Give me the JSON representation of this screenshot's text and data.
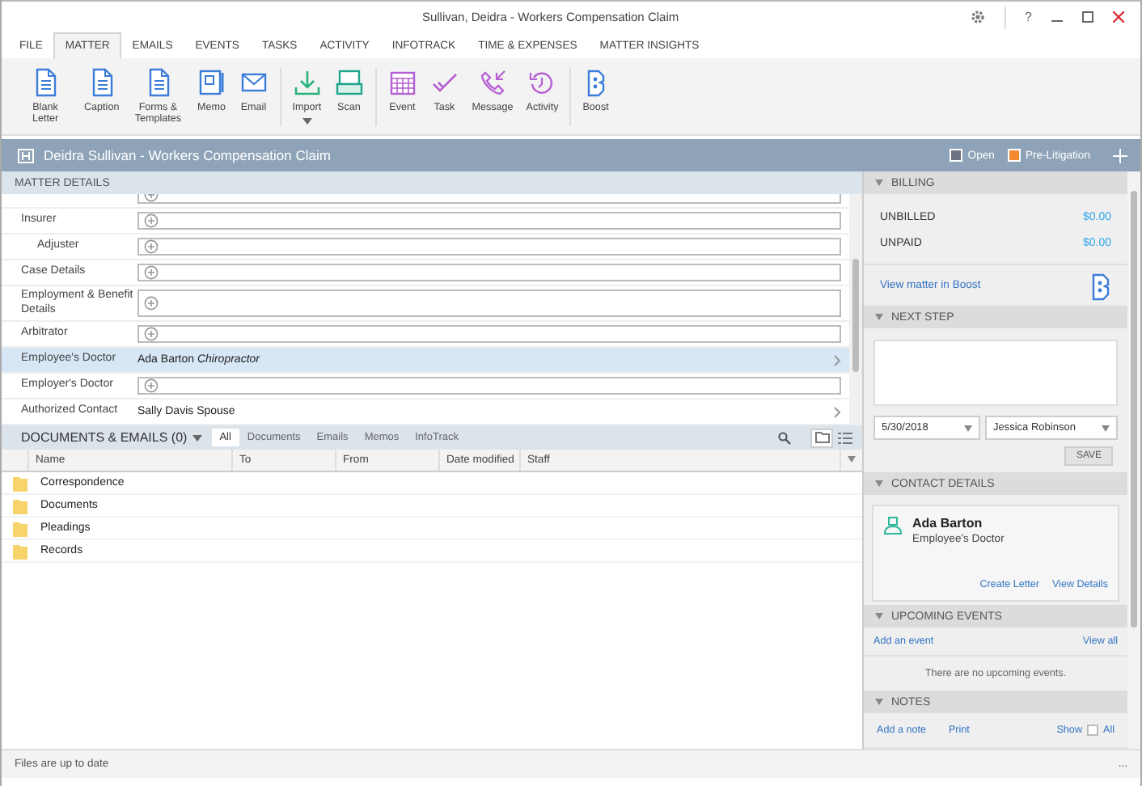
{
  "window": {
    "title": "Sullivan, Deidra - Workers Compensation Claim",
    "help": "?"
  },
  "tabs": [
    {
      "label": "FILE",
      "selected": false
    },
    {
      "label": "MATTER",
      "selected": true
    },
    {
      "label": "EMAILS",
      "selected": false
    },
    {
      "label": "EVENTS",
      "selected": false
    },
    {
      "label": "TASKS",
      "selected": false
    },
    {
      "label": "ACTIVITY",
      "selected": false
    },
    {
      "label": "INFOTRACK",
      "selected": false
    },
    {
      "label": "TIME & EXPENSES",
      "selected": false
    },
    {
      "label": "MATTER INSIGHTS",
      "selected": false
    }
  ],
  "ribbon": {
    "groups": [
      {
        "buttons": [
          {
            "label": "Blank Letter",
            "dropdown": false
          },
          {
            "label": "Caption",
            "dropdown": false
          },
          {
            "label": "Forms & Templates",
            "dropdown": false
          },
          {
            "label": "Memo",
            "dropdown": false
          },
          {
            "label": "Email",
            "dropdown": false
          }
        ]
      },
      {
        "buttons": [
          {
            "label": "Import",
            "dropdown": true
          },
          {
            "label": "Scan",
            "dropdown": false
          }
        ]
      },
      {
        "buttons": [
          {
            "label": "Event",
            "dropdown": false
          },
          {
            "label": "Task",
            "dropdown": false
          },
          {
            "label": "Message",
            "dropdown": false
          },
          {
            "label": "Activity",
            "dropdown": false
          }
        ]
      },
      {
        "buttons": [
          {
            "label": "Boost",
            "dropdown": false
          }
        ]
      }
    ]
  },
  "matter": {
    "title": "Deidra Sullivan - Workers Compensation Claim",
    "statuses": [
      {
        "label": "Open",
        "color": "#6b7480"
      },
      {
        "label": "Pre-Litigation",
        "color": "#f28b30"
      }
    ]
  },
  "matter_details": {
    "title": "MATTER DETAILS",
    "rows": [
      {
        "kind": "field",
        "selected": false
      },
      {
        "kind": "field",
        "label": "Insurer",
        "selected": false,
        "children": [
          {
            "kind": "field",
            "label": "Adjuster",
            "selected": false
          }
        ]
      },
      {
        "kind": "field",
        "label": "Case Details",
        "selected": false
      },
      {
        "kind": "field",
        "label": "Employment & Benefit Details",
        "selected": false
      },
      {
        "kind": "field",
        "label": "Arbitrator",
        "selected": false
      },
      {
        "kind": "value",
        "label": "Employee's Doctor",
        "value": "Ada Barton *Chiropractor*",
        "selected": true
      },
      {
        "kind": "field",
        "label": "Employer's Doctor",
        "selected": false
      },
      {
        "kind": "value",
        "label": "Authorized Contact",
        "value": "Sally Davis Spouse",
        "selected": false
      }
    ]
  },
  "documents": {
    "title": "DOCUMENTS & EMAILS (0)",
    "filters": [
      {
        "label": "All",
        "selected": true
      },
      {
        "label": "Documents",
        "selected": false
      },
      {
        "label": "Emails",
        "selected": false
      },
      {
        "label": "Memos",
        "selected": false
      },
      {
        "label": "InfoTrack",
        "selected": false
      }
    ],
    "view_modes": [
      {
        "kind": "folder",
        "selected": true
      },
      {
        "kind": "list",
        "selected": false
      }
    ],
    "columns": [
      "Name",
      "To",
      "From",
      "Date modified",
      "Staff"
    ],
    "rows": [
      {
        "name": "Correspondence"
      },
      {
        "name": "Documents"
      },
      {
        "name": "Pleadings"
      },
      {
        "name": "Records"
      }
    ]
  },
  "sidebar": {
    "billing": {
      "title": "BILLING",
      "items": [
        {
          "label": "UNBILLED",
          "amount": "$0.00"
        },
        {
          "label": "UNPAID",
          "amount": "$0.00"
        }
      ],
      "link": "View matter in Boost"
    },
    "next_step": {
      "title": "NEXT STEP",
      "date": "5/30/2018",
      "assignee": "Jessica Robinson",
      "button": "SAVE"
    },
    "contact_details": {
      "title": "CONTACT DETAILS",
      "name": "Ada Barton",
      "role": "Employee's Doctor",
      "links": [
        "Create Letter",
        "View Details"
      ]
    },
    "upcoming_events": {
      "title": "UPCOMING EVENTS",
      "links": [
        "Add an event",
        "View all"
      ],
      "empty_text": "There are no upcoming events."
    },
    "notes": {
      "title": "NOTES",
      "links": [
        "Add a note",
        "Print"
      ],
      "show_label": "Show",
      "show_all": {
        "label": "All",
        "checked": false
      }
    }
  },
  "status_bar": {
    "text": "Files are up to date",
    "more": "..."
  }
}
